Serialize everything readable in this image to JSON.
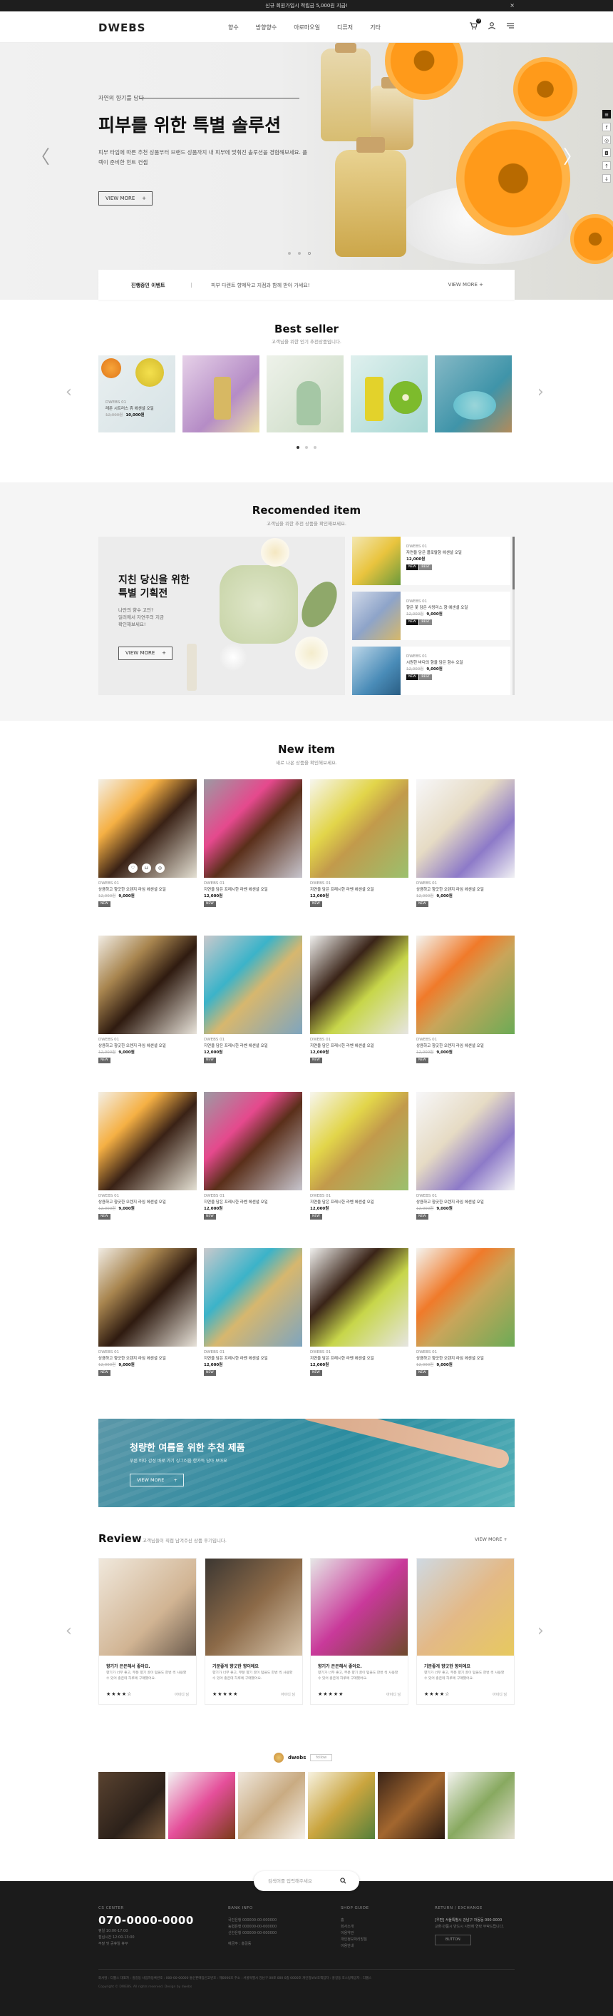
{
  "topbar": {
    "text": "신규 회원가입시 적립금 5,000원 지급!",
    "close": "×"
  },
  "header": {
    "logo": "DWEBS",
    "nav": [
      "향수",
      "방향향수",
      "아로마오일",
      "디퓨저",
      "기타"
    ],
    "cart_count": "0"
  },
  "hero": {
    "kicker": "자연의 향기를 담다",
    "title": "피부를 위한 특별 솔루션",
    "desc": "피부 타입에 따른 추천 상품부터 브랜드 상품까지 내 피부에 맞춰진 솔루션을 경험해보세요. 플렉이 준비한 힌트 컨셉",
    "button": "VIEW MORE",
    "prev": "〈",
    "next": "〉"
  },
  "event": {
    "label": "진행중인 이벤트",
    "text": "피부 다렌트 향제작고 지점과 함께 받아 가세요!",
    "more": "VIEW MORE"
  },
  "best": {
    "title": "Best seller",
    "sub": "고객님을 위한 인기 추천상품입니다.",
    "item": {
      "brand": "DWEBS 01",
      "name": "레몬 시트러스 휴 에센셜 오일",
      "old": "12,000원",
      "price": "10,000원"
    }
  },
  "recommend": {
    "title": "Recomended item",
    "sub": "고객님을 위한 추천 상품을 확인해보세요.",
    "banner_title_1": "지친 당신을 위한",
    "banner_title_2": "특별 기획전",
    "banner_desc": [
      "나만의 향수 고민?",
      "일러에서 자연주의 지금",
      "확인해보세요!"
    ],
    "button": "VIEW MORE",
    "items": [
      {
        "brand": "DWEBS 01",
        "name": "자연을 담은 플로랄향 에센셜 오일",
        "old": "",
        "price": "12,000원"
      },
      {
        "brand": "DWEBS 01",
        "name": "향은 꽃 담은 사랑리스 향 에센셜 오일",
        "old": "12,000원",
        "price": "9,000원"
      },
      {
        "brand": "DWEBS 01",
        "name": "시원한 바다의 향을 담은 향수 오일",
        "old": "12,000원",
        "price": "9,000원"
      }
    ]
  },
  "newitem": {
    "title": "New item",
    "sub": "새로 나온 상품을 확인해보세요.",
    "brand": "DWEBS 01",
    "name_a": "상큼하고 향긋한 오렌지 라임 에센셜 오일",
    "name_b": "지연을 담은 프레시한 라벤 에센셜 오일",
    "old": "12,000원",
    "price": "9,000원",
    "price_b": "12,000원",
    "badge": "NEW"
  },
  "promo": {
    "title": "청량한 여름을 위한 추천 제품",
    "desc": "푸른 바다 감성 바로 가기 싱그러움 한가득 담아 보아요",
    "button": "VIEW MORE"
  },
  "review": {
    "title": "Review",
    "sub": "고객님들이 직접 남겨주신 상품 후기입니다.",
    "more": "VIEW MORE",
    "items": [
      {
        "title": "향기가 은은해서 좋아요.",
        "desc": "향기가 너무 좋고, 부분 향기 골이 텀을도 한번 씩 사용할 수 있어 좋은데 하루에 구매했어요.",
        "stars": "★★★★☆",
        "meta": "아이디 님"
      },
      {
        "title": "기분좋게 향긋한 향이에요",
        "desc": "향기가 너무 좋고, 부분 향기 골이 텀을도 한번 씩 사용할 수 있어 좋은데 하루에 구매했어요.",
        "stars": "★★★★★",
        "meta": "아이디 님"
      },
      {
        "title": "향기가 은은해서 좋아요.",
        "desc": "향기가 너무 좋고, 부분 향기 골이 텀을도 한번 씩 사용할 수 있어 좋은데 하루에 구매했어요.",
        "stars": "★★★★★",
        "meta": "아이디 님"
      },
      {
        "title": "기분좋게 향긋한 향이에요",
        "desc": "향기가 너무 좋고, 부분 향기 골이 텀을도 한번 씩 사용할 수 있어 좋은데 하루에 구매했어요.",
        "stars": "★★★★☆",
        "meta": "아이디 님"
      }
    ]
  },
  "insta": {
    "name": "dwebs",
    "follow": "follow"
  },
  "search": {
    "placeholder": "검색어를 입력해주세요"
  },
  "footer": {
    "cs_head": "CS CENTER",
    "phone": "070-0000-0000",
    "cs_lines": [
      "평일 10:00-17:00",
      "점심시간 12:00-13:00",
      "주말 및 공휴일 휴무"
    ],
    "bank_head": "BANK INFO",
    "bank_lines": [
      "국민은행 000000-00-000000",
      "농협은행 000000-00-000000",
      "신한은행 000000-00-000000",
      "예금주 : 홍길동"
    ],
    "shop_head": "SHOP GUIDE",
    "shop_lines": [
      "홈",
      "회사소개",
      "이용약관",
      "개인정보처리방침",
      "이용안내"
    ],
    "ret_head": "RETURN / EXCHANGE",
    "ret_lines": [
      "[우편] 서울특별시 강남구 자동동 000-0000",
      "교환·반품시 반드시 사전에 연락 부탁드립니다."
    ],
    "ret_btn": "BUTTON",
    "links": "회사명 : 디웹스   대표자 : 홍길동   사업자등록번호 : 000-00-00000   통신판매업신고번호 : 제0000호   주소 : 서울특별시 강남구 00로 000 0층 0000호   개인정보보호책임자 : 홍길동   호스팅제공자 : 디웹스",
    "copy": "Copyright © DWEBS. All rights reserved. Design by dwebs"
  },
  "colors": {
    "dark": "#1b1b1b",
    "accent": "#ff9a1a"
  }
}
